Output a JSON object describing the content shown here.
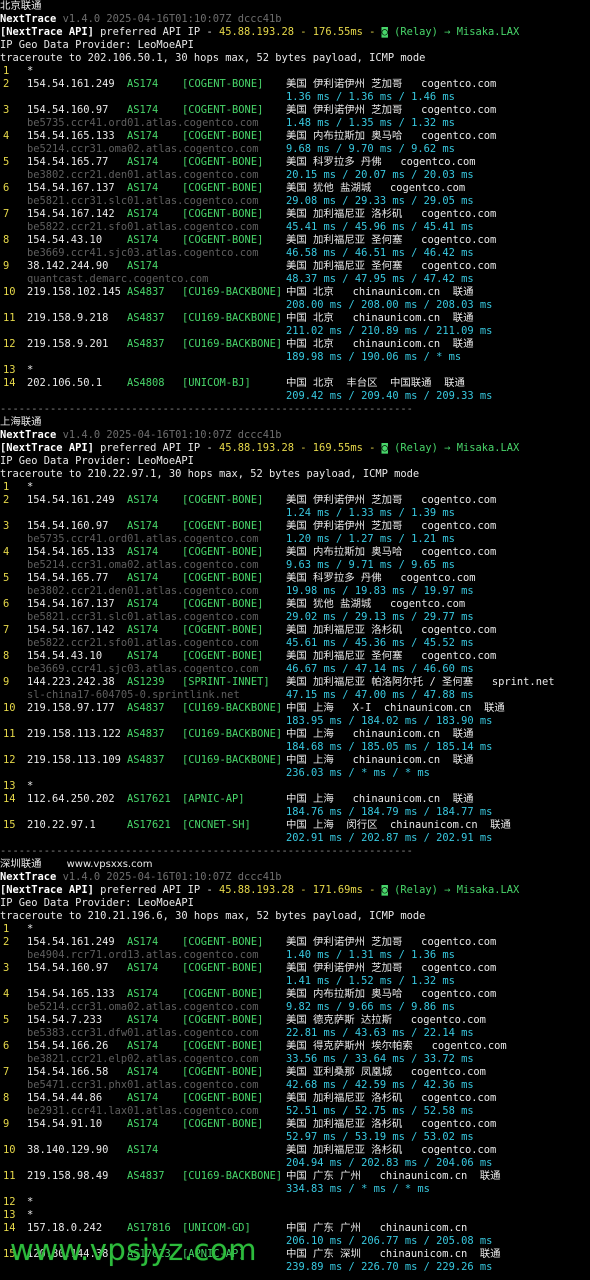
{
  "watermark_bottom": "www.vpsjyz.com",
  "colors": {
    "bg": "#000000",
    "hop": "#e6d84a",
    "asn": "#48d66a",
    "rtt": "#38c8df",
    "rdns": "#5f5f5f",
    "watermark": "#2dbb3c"
  },
  "sections": [
    {
      "title": "北京联通",
      "title_extra": "",
      "app_line": [
        "NextTrace",
        " v1.4.0 2025-04-16T01:10:07Z dccc41b"
      ],
      "api_line": [
        "[NextTrace API]",
        " preferred API IP - ",
        "45.88.193.28 - 176.55ms - ",
        "◙ (Relay) → Misaka.LAX"
      ],
      "provider_line": "IP Geo Data Provider: LeoMoeAPI",
      "trace_line": "traceroute to 202.106.50.1, 30 hops max, 52 bytes payload, ICMP mode",
      "hops": [
        {
          "n": "1",
          "ip": "*"
        },
        {
          "n": "2",
          "ip": "154.54.161.249",
          "asn": "AS174",
          "tag": "[COGENT-BONE]",
          "geo": "美国 伊利诺伊州 芝加哥   cogentco.com",
          "rtt": "1.36 ms / 1.36 ms / 1.46 ms"
        },
        {
          "n": "3",
          "ip": "154.54.160.97",
          "asn": "AS174",
          "tag": "[COGENT-BONE]",
          "geo": "美国 伊利诺伊州 芝加哥   cogentco.com",
          "rdns": "be5735.ccr41.ord01.atlas.cogentco.com",
          "rtt": "1.48 ms / 1.35 ms / 1.32 ms"
        },
        {
          "n": "4",
          "ip": "154.54.165.133",
          "asn": "AS174",
          "tag": "[COGENT-BONE]",
          "geo": "美国 内布拉斯加 奥马哈   cogentco.com",
          "rdns": "be5214.ccr31.oma02.atlas.cogentco.com",
          "rtt": "9.68 ms / 9.70 ms / 9.62 ms"
        },
        {
          "n": "5",
          "ip": "154.54.165.77",
          "asn": "AS174",
          "tag": "[COGENT-BONE]",
          "geo": "美国 科罗拉多 丹佛   cogentco.com",
          "rdns": "be3802.ccr21.den01.atlas.cogentco.com",
          "rtt": "20.15 ms / 20.07 ms / 20.03 ms"
        },
        {
          "n": "6",
          "ip": "154.54.167.137",
          "asn": "AS174",
          "tag": "[COGENT-BONE]",
          "geo": "美国 犹他 盐湖城   cogentco.com",
          "rdns": "be5821.ccr31.slc01.atlas.cogentco.com",
          "rtt": "29.08 ms / 29.33 ms / 29.05 ms"
        },
        {
          "n": "7",
          "ip": "154.54.167.142",
          "asn": "AS174",
          "tag": "[COGENT-BONE]",
          "geo": "美国 加利福尼亚 洛杉矶   cogentco.com",
          "rdns": "be5822.ccr21.sfo01.atlas.cogentco.com",
          "rtt": "45.41 ms / 45.96 ms / 45.41 ms"
        },
        {
          "n": "8",
          "ip": "154.54.43.10",
          "asn": "AS174",
          "tag": "[COGENT-BONE]",
          "geo": "美国 加利福尼亚 圣何塞   cogentco.com",
          "rdns": "be3669.ccr41.sjc03.atlas.cogentco.com",
          "rtt": "46.58 ms / 46.51 ms / 46.42 ms"
        },
        {
          "n": "9",
          "ip": "38.142.244.90",
          "asn": "AS174",
          "tag": "",
          "geo": "美国 加利福尼亚 圣何塞   cogentco.com",
          "rdns": "quantcast.demarc.cogentco.com",
          "rtt": "48.37 ms / 47.95 ms / 47.42 ms"
        },
        {
          "n": "10",
          "ip": "219.158.102.145",
          "asn": "AS4837",
          "tag": "[CU169-BACKBONE]",
          "geo": "中国 北京   chinaunicom.cn  联通",
          "rtt": "208.00 ms / 208.00 ms / 208.03 ms"
        },
        {
          "n": "11",
          "ip": "219.158.9.218",
          "asn": "AS4837",
          "tag": "[CU169-BACKBONE]",
          "geo": "中国 北京   chinaunicom.cn  联通",
          "rtt": "211.02 ms / 210.89 ms / 211.09 ms"
        },
        {
          "n": "12",
          "ip": "219.158.9.201",
          "asn": "AS4837",
          "tag": "[CU169-BACKBONE]",
          "geo": "中国 北京   chinaunicom.cn  联通",
          "rtt": "189.98 ms / 190.06 ms / * ms"
        },
        {
          "n": "13",
          "ip": "*"
        },
        {
          "n": "14",
          "ip": "202.106.50.1",
          "asn": "AS4808",
          "tag": "[UNICOM-BJ]",
          "geo": "中国 北京  丰台区  中国联通  联通",
          "rtt": "209.42 ms / 209.40 ms / 209.33 ms"
        }
      ]
    },
    {
      "title": "上海联通",
      "title_extra": "",
      "app_line": [
        "NextTrace",
        " v1.4.0 2025-04-16T01:10:07Z dccc41b"
      ],
      "api_line": [
        "[NextTrace API]",
        " preferred API IP - ",
        "45.88.193.28 - 169.55ms - ",
        "◙ (Relay) → Misaka.LAX"
      ],
      "provider_line": "IP Geo Data Provider: LeoMoeAPI",
      "trace_line": "traceroute to 210.22.97.1, 30 hops max, 52 bytes payload, ICMP mode",
      "hops": [
        {
          "n": "1",
          "ip": "*"
        },
        {
          "n": "2",
          "ip": "154.54.161.249",
          "asn": "AS174",
          "tag": "[COGENT-BONE]",
          "geo": "美国 伊利诺伊州 芝加哥   cogentco.com",
          "rtt": "1.24 ms / 1.33 ms / 1.39 ms"
        },
        {
          "n": "3",
          "ip": "154.54.160.97",
          "asn": "AS174",
          "tag": "[COGENT-BONE]",
          "geo": "美国 伊利诺伊州 芝加哥   cogentco.com",
          "rdns": "be5735.ccr41.ord01.atlas.cogentco.com",
          "rtt": "1.20 ms / 1.27 ms / 1.21 ms"
        },
        {
          "n": "4",
          "ip": "154.54.165.133",
          "asn": "AS174",
          "tag": "[COGENT-BONE]",
          "geo": "美国 内布拉斯加 奥马哈   cogentco.com",
          "rdns": "be5214.ccr31.oma02.atlas.cogentco.com",
          "rtt": "9.63 ms / 9.71 ms / 9.65 ms"
        },
        {
          "n": "5",
          "ip": "154.54.165.77",
          "asn": "AS174",
          "tag": "[COGENT-BONE]",
          "geo": "美国 科罗拉多 丹佛   cogentco.com",
          "rdns": "be3802.ccr21.den01.atlas.cogentco.com",
          "rtt": "19.98 ms / 19.83 ms / 19.97 ms"
        },
        {
          "n": "6",
          "ip": "154.54.167.137",
          "asn": "AS174",
          "tag": "[COGENT-BONE]",
          "geo": "美国 犹他 盐湖城   cogentco.com",
          "rdns": "be5821.ccr31.slc01.atlas.cogentco.com",
          "rtt": "29.02 ms / 29.13 ms / 29.77 ms"
        },
        {
          "n": "7",
          "ip": "154.54.167.142",
          "asn": "AS174",
          "tag": "[COGENT-BONE]",
          "geo": "美国 加利福尼亚 洛杉矶   cogentco.com",
          "rdns": "be5822.ccr21.sfo01.atlas.cogentco.com",
          "rtt": "45.61 ms / 45.36 ms / 45.52 ms"
        },
        {
          "n": "8",
          "ip": "154.54.43.10",
          "asn": "AS174",
          "tag": "[COGENT-BONE]",
          "geo": "美国 加利福尼亚 圣何塞   cogentco.com",
          "rdns": "be3669.ccr41.sjc03.atlas.cogentco.com",
          "rtt": "46.67 ms / 47.14 ms / 46.60 ms"
        },
        {
          "n": "9",
          "ip": "144.223.242.38",
          "asn": "AS1239",
          "tag": "[SPRINT-INNET]",
          "geo": "美国 加利福尼亚 帕洛阿尔托 / 圣何塞   sprint.net",
          "rdns": "sl-china17-604705-0.sprintlink.net",
          "rtt": "47.15 ms / 47.00 ms / 47.88 ms"
        },
        {
          "n": "10",
          "ip": "219.158.97.177",
          "asn": "AS4837",
          "tag": "[CU169-BACKBONE]",
          "geo": "中国 上海   X-I  chinaunicom.cn  联通",
          "rtt": "183.95 ms / 184.02 ms / 183.90 ms"
        },
        {
          "n": "11",
          "ip": "219.158.113.122",
          "asn": "AS4837",
          "tag": "[CU169-BACKBONE]",
          "geo": "中国 上海   chinaunicom.cn  联通",
          "rtt": "184.68 ms / 185.05 ms / 185.14 ms"
        },
        {
          "n": "12",
          "ip": "219.158.113.109",
          "asn": "AS4837",
          "tag": "[CU169-BACKBONE]",
          "geo": "中国 上海   chinaunicom.cn  联通",
          "rtt": "236.03 ms / * ms / * ms"
        },
        {
          "n": "13",
          "ip": "*"
        },
        {
          "n": "14",
          "ip": "112.64.250.202",
          "asn": "AS17621",
          "tag": "[APNIC-AP]",
          "geo": "中国 上海   chinaunicom.cn  联通",
          "rtt": "184.76 ms / 184.79 ms / 184.77 ms"
        },
        {
          "n": "15",
          "ip": "210.22.97.1",
          "asn": "AS17621",
          "tag": "[CNCNET-SH]",
          "geo": "中国 上海  闵行区  chinaunicom.cn  联通",
          "rtt": "202.91 ms / 202.87 ms / 202.91 ms"
        }
      ]
    },
    {
      "title": "深圳联通",
      "title_extra": "www.vpsxxs.com",
      "app_line": [
        "NextTrace",
        " v1.4.0 2025-04-16T01:10:07Z dccc41b"
      ],
      "api_line": [
        "[NextTrace API]",
        " preferred API IP - ",
        "45.88.193.28 - 171.69ms - ",
        "◙ (Relay) → Misaka.LAX"
      ],
      "provider_line": "IP Geo Data Provider: LeoMoeAPI",
      "trace_line": "traceroute to 210.21.196.6, 30 hops max, 52 bytes payload, ICMP mode",
      "hops": [
        {
          "n": "1",
          "ip": "*"
        },
        {
          "n": "2",
          "ip": "154.54.161.249",
          "asn": "AS174",
          "tag": "[COGENT-BONE]",
          "geo": "美国 伊利诺伊州 芝加哥   cogentco.com",
          "rdns": "be4904.rcr71.ord13.atlas.cogentco.com",
          "rtt": "1.40 ms / 1.31 ms / 1.36 ms"
        },
        {
          "n": "3",
          "ip": "154.54.160.97",
          "asn": "AS174",
          "tag": "[COGENT-BONE]",
          "geo": "美国 伊利诺伊州 芝加哥   cogentco.com",
          "rtt": "1.41 ms / 1.52 ms / 1.32 ms"
        },
        {
          "n": "4",
          "ip": "154.54.165.133",
          "asn": "AS174",
          "tag": "[COGENT-BONE]",
          "geo": "美国 内布拉斯加 奥马哈   cogentco.com",
          "rdns": "be5214.ccr31.oma02.atlas.cogentco.com",
          "rtt": "9.82 ms / 9.66 ms / 9.86 ms"
        },
        {
          "n": "5",
          "ip": "154.54.7.233",
          "asn": "AS174",
          "tag": "[COGENT-BONE]",
          "geo": "美国 德克萨斯 达拉斯   cogentco.com",
          "rdns": "be5383.ccr31.dfw01.atlas.cogentco.com",
          "rtt": "22.81 ms / 43.63 ms / 22.14 ms"
        },
        {
          "n": "6",
          "ip": "154.54.166.26",
          "asn": "AS174",
          "tag": "[COGENT-BONE]",
          "geo": "美国 得克萨斯州 埃尔帕索   cogentco.com",
          "rdns": "be3821.ccr21.elp02.atlas.cogentco.com",
          "rtt": "33.56 ms / 33.64 ms / 33.72 ms"
        },
        {
          "n": "7",
          "ip": "154.54.166.58",
          "asn": "AS174",
          "tag": "[COGENT-BONE]",
          "geo": "美国 亚利桑那 凤凰城   cogentco.com",
          "rdns": "be5471.ccr31.phx01.atlas.cogentco.com",
          "rtt": "42.68 ms / 42.59 ms / 42.36 ms"
        },
        {
          "n": "8",
          "ip": "154.54.44.86",
          "asn": "AS174",
          "tag": "[COGENT-BONE]",
          "geo": "美国 加利福尼亚 洛杉矶   cogentco.com",
          "rdns": "be2931.ccr41.lax01.atlas.cogentco.com",
          "rtt": "52.51 ms / 52.75 ms / 52.58 ms"
        },
        {
          "n": "9",
          "ip": "154.54.91.10",
          "asn": "AS174",
          "tag": "[COGENT-BONE]",
          "geo": "美国 加利福尼亚 洛杉矶   cogentco.com",
          "rtt": "52.97 ms / 53.19 ms / 53.02 ms"
        },
        {
          "n": "10",
          "ip": "38.140.129.90",
          "asn": "AS174",
          "tag": "",
          "geo": "美国 加利福尼亚 洛杉矶   cogentco.com",
          "rtt": "204.94 ms / 202.83 ms / 204.06 ms"
        },
        {
          "n": "11",
          "ip": "219.158.98.49",
          "asn": "AS4837",
          "tag": "[CU169-BACKBONE]",
          "geo": "中国 广东 广州   chinaunicom.cn  联通",
          "rtt": "334.83 ms / * ms / * ms"
        },
        {
          "n": "12",
          "ip": "*"
        },
        {
          "n": "13",
          "ip": "*"
        },
        {
          "n": "14",
          "ip": "157.18.0.242",
          "asn": "AS17816",
          "tag": "[UNICOM-GD]",
          "geo": "中国 广东 广州   chinaunicom.cn",
          "rtt": "206.10 ms / 206.77 ms / 205.08 ms"
        },
        {
          "n": "15",
          "ip": "120.80.144.38",
          "asn": "AS17623",
          "tag": "[APNIC-AP]",
          "geo": "中国 广东 深圳   chinaunicom.cn  联通",
          "rtt": "239.89 ms / 226.70 ms / 229.26 ms"
        }
      ]
    }
  ]
}
